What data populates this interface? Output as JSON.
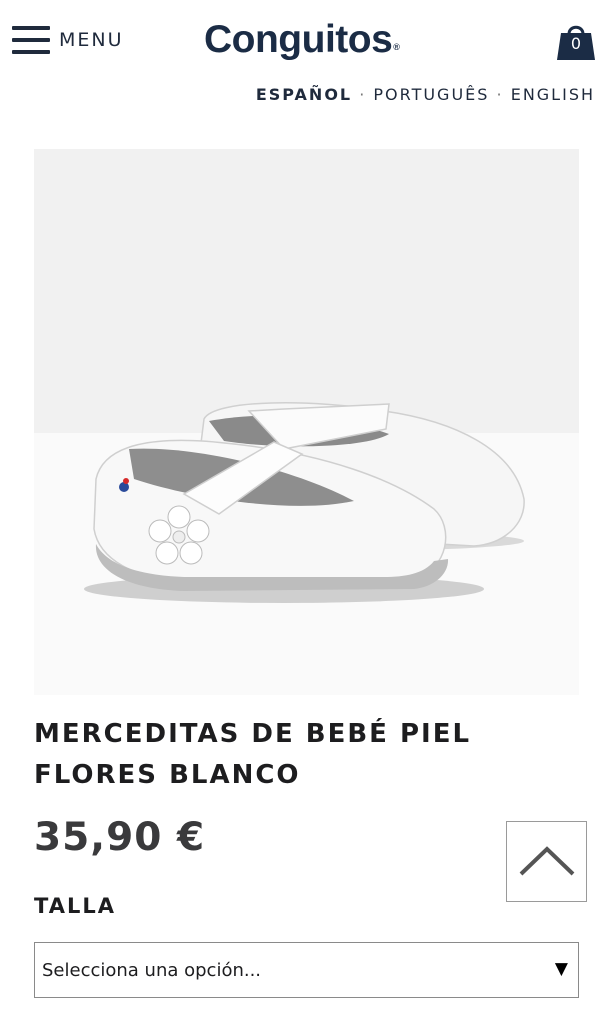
{
  "header": {
    "menu_label": "MENU",
    "logo_text": "Conguitos",
    "logo_mark": "®",
    "cart_count": "0"
  },
  "languages": [
    {
      "label": "ESPAÑOL",
      "active": true
    },
    {
      "label": "PORTUGUÊS",
      "active": false
    },
    {
      "label": "ENGLISH",
      "active": false
    }
  ],
  "language_separator": " · ",
  "product": {
    "title": "MERCEDITAS DE BEBÉ PIEL FLORES BLANCO",
    "price": "35,90 €",
    "size_label": "TALLA",
    "size_select_value": "Selecciona una opción...",
    "size_select_arrow": "▼"
  },
  "colors": {
    "brand_navy": "#1b2c45",
    "text_dark": "#1d1d1f",
    "price_gray": "#3a3a3c",
    "image_bg": "#f1f1f1"
  },
  "icons": {
    "menu": "hamburger-icon",
    "cart": "shopping-bag-icon",
    "back_to_top": "chevron-up-icon"
  }
}
